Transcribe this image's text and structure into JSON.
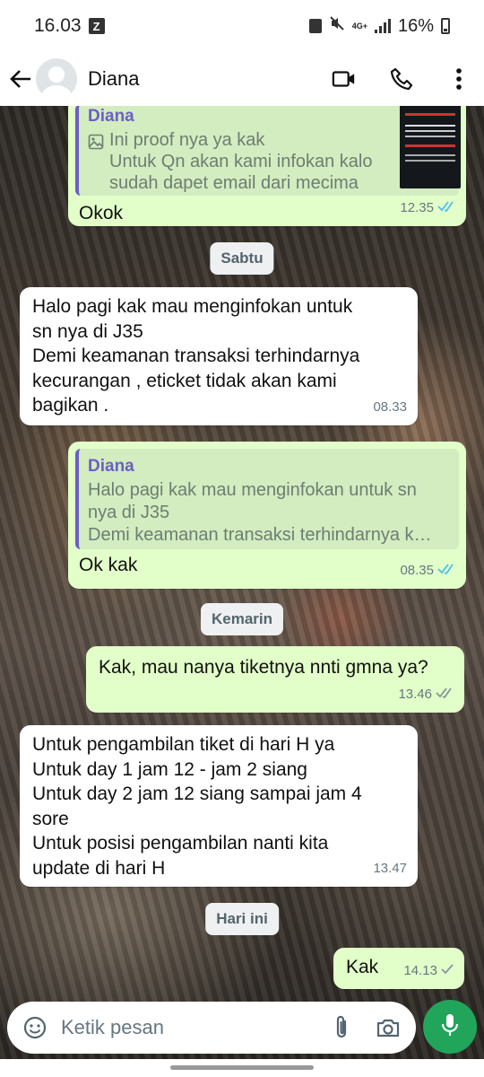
{
  "status_bar": {
    "time": "16.03",
    "notification_badge": "Z",
    "network": "4G+",
    "battery": "16%"
  },
  "header": {
    "contact_name": "Diana"
  },
  "messages": [
    {
      "direction": "outgoing",
      "quote": {
        "name": "Diana",
        "text": "Ini proof nya ya kak\nUntuk Qn akan kami infokan kalo\nsudah dapet email dari mecima"
      },
      "text": "Okok",
      "time": "12.35",
      "status": "read"
    },
    {
      "type": "date",
      "label": "Sabtu"
    },
    {
      "direction": "incoming",
      "text": "Halo pagi kak mau menginfokan untuk\nsn nya di J35\nDemi keamanan transaksi terhindarnya\nkecurangan , eticket tidak akan kami\nbagikan .",
      "time": "08.33"
    },
    {
      "direction": "outgoing",
      "quote": {
        "name": "Diana",
        "text": "Halo pagi kak mau menginfokan untuk sn\nnya di J35\nDemi keamanan transaksi terhindarnya k…"
      },
      "text": "Ok kak",
      "time": "08.35",
      "status": "read"
    },
    {
      "type": "date",
      "label": "Kemarin"
    },
    {
      "direction": "outgoing",
      "text": "Kak, mau nanya tiketnya nnti gmna ya?",
      "time": "13.46",
      "status": "delivered"
    },
    {
      "direction": "incoming",
      "text": "Untuk pengambilan tiket di hari H ya\nUntuk day 1 jam 12 - jam 2 siang\nUntuk day 2 jam 12 siang sampai jam 4\nsore\nUntuk posisi pengambilan nanti kita\nupdate di hari H",
      "time": "13.47"
    },
    {
      "type": "date",
      "label": "Hari ini"
    },
    {
      "direction": "outgoing",
      "text": "Kak",
      "time": "14.13",
      "status": "sent"
    }
  ],
  "composer": {
    "placeholder": "Ketik pesan"
  },
  "colors": {
    "outgoing_bubble": "#e2fec9",
    "incoming_bubble": "#ffffff",
    "accent_green": "#21a55b",
    "read_tick": "#53bdeb",
    "quote_bar": "#6c5ec7"
  },
  "icons": [
    "back-arrow-icon",
    "video-call-icon",
    "phone-icon",
    "more-options-icon",
    "image-icon",
    "emoji-icon",
    "attach-icon",
    "camera-icon",
    "mic-icon"
  ]
}
